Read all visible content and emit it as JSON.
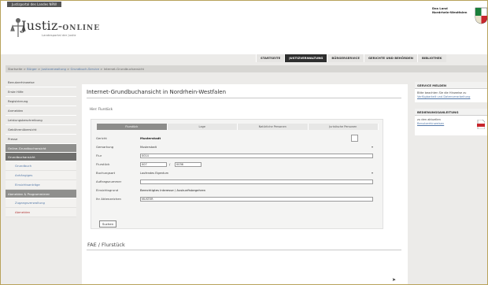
{
  "header": {
    "topbar_label": "Justizportal des Landes NRW",
    "logo_main": "Justiz-",
    "logo_accent": "ONLINE",
    "logo_sub": "Landesportal der Justiz",
    "state_line1": "Das Land",
    "state_line2": "Nordrhein-Westfalen",
    "crest_color": "#1a7f3b"
  },
  "topnav": [
    {
      "label": "STARTSEITE",
      "active": false
    },
    {
      "label": "JUSTIZVERWALTUNG",
      "active": true
    },
    {
      "label": "BÜRGERSERVICE",
      "active": false
    },
    {
      "label": "GERICHTE UND BEHÖRDEN",
      "active": false
    },
    {
      "label": "BIBLIOTHEK",
      "active": false
    }
  ],
  "breadcrumb": {
    "prefix": "Startseite",
    "items": [
      "Bürger",
      "Justizverwaltung",
      "Grundbuch-Service",
      "Internet-Grundbuchansicht"
    ]
  },
  "sidebar": {
    "items": [
      "Benutzerhinweise",
      "Erste Hilfe",
      "Registrierung",
      "Anmelden",
      "Leistungsbeschreibung",
      "Gebührenübersicht",
      "Presse"
    ],
    "group1": "Online-Grundbuchansicht",
    "group2": "Grundbuchansicht",
    "sub1": [
      "Grundbuch",
      "Anhängiges",
      "Einsichtsanträge"
    ],
    "group3": "Abmelden & Programmierer",
    "sub2": [
      "Zugangsverwaltung",
      "Abmelden"
    ]
  },
  "main": {
    "title": "Internet-Grundbuchansicht in Nordrhein-Westfalen",
    "subtitle": "Hier: Flurstück",
    "tabs": [
      {
        "label": "Flurstück",
        "active": true
      },
      {
        "label": "Lage",
        "active": false
      },
      {
        "label": "Natürliche Personen",
        "active": false
      },
      {
        "label": "Juristische Personen",
        "active": false
      }
    ],
    "form": {
      "gericht_label": "Gericht",
      "gericht_value": "Musterstadt",
      "gemarkung_label": "Gemarkung",
      "gemarkung_value": "Musterstadt",
      "flur_label": "Flur",
      "flur_value": "0014",
      "flurstueck_label": "Flurstück",
      "flurstueck_von": "007",
      "flurstueck_sep": "/",
      "flurstueck_bis": "0036",
      "buchungsart_label": "Buchungsart",
      "buchungsart_value": "Laufendes Eigentum",
      "auftrag_label": "Auftragsnummer",
      "auftrag_value": "",
      "zweck_label": "Einsichtsgrund",
      "zweck_value": "Berechtigtes Interesse / Auskunftsbegehren",
      "aktenzeichen_label": "Ihr Aktenzeichen",
      "aktenzeichen_value": "MUSTER",
      "submit_label": "Suchen"
    },
    "result_title": "FAE / Flurstück"
  },
  "right": {
    "box1": {
      "head": "SERVICE MELDEN",
      "text": "Bitte beachten Sie die Hinweise zu",
      "link": "Verfügbarkeit und Datenverarbeitung"
    },
    "box2": {
      "head": "BEDIENUNGSANLEITUNG",
      "text": "zu den aktuellen",
      "link": "Benutzerhinweisen"
    }
  }
}
